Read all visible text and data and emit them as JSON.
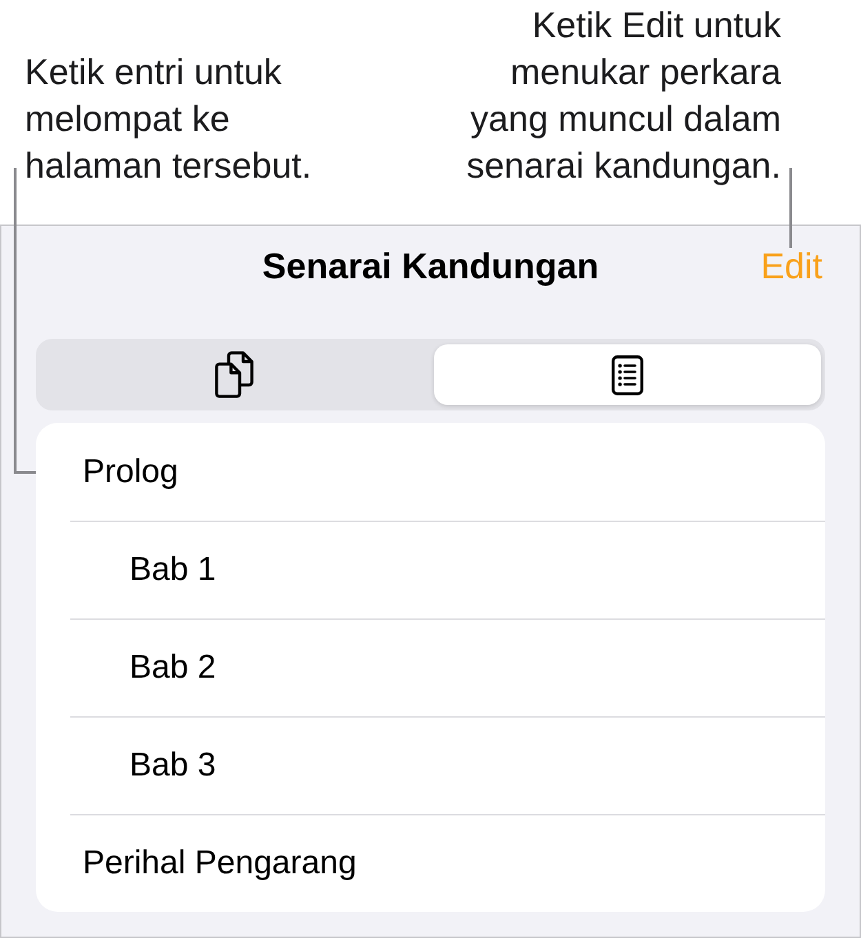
{
  "annotations": [
    {
      "text": "Ketik entri untuk melompat ke halaman tersebut."
    },
    {
      "text": "Ketik Edit untuk menukar perkara yang muncul dalam senarai kandungan."
    }
  ],
  "header": {
    "title": "Senarai Kandungan",
    "edit_button": "Edit"
  },
  "view_switcher": [
    {
      "kind": "pages",
      "selected": false
    },
    {
      "kind": "list",
      "selected": true
    }
  ],
  "contents": [
    {
      "label": "Prolog",
      "children": [
        {
          "label": "Bab 1"
        },
        {
          "label": "Bab 2"
        },
        {
          "label": "Bab 3"
        }
      ]
    },
    {
      "label": "Perihal Pengarang"
    }
  ]
}
